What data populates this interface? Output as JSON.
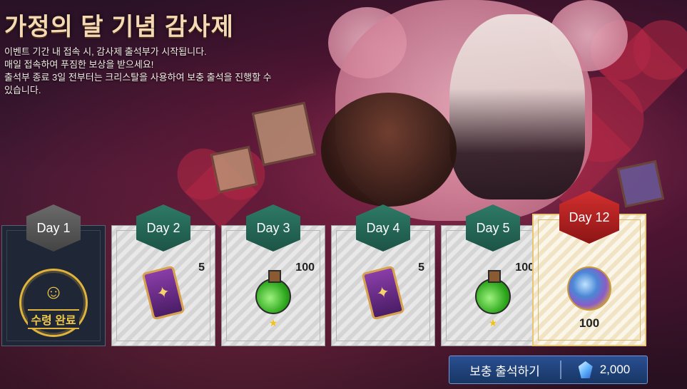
{
  "event": {
    "title": "가정의 달 기념 감사제",
    "description": [
      "이벤트 기간 내 접속 시, 감사제 출석부가 시작됩니다.",
      "매일 접속하여 푸짐한 보상을 받으세요!",
      "출석부 종료 3일 전부터는 크리스탈을 사용하여 보충 출석을 진행할 수",
      "있습니다."
    ]
  },
  "days": [
    {
      "label": "Day 1",
      "status": "received",
      "stamp_text": "수령 완료"
    },
    {
      "label": "Day 2",
      "quantity": "5",
      "item_icon": "card-item-icon"
    },
    {
      "label": "Day 3",
      "quantity": "100",
      "item_icon": "potion-icon",
      "star": "★"
    },
    {
      "label": "Day 4",
      "quantity": "5",
      "item_icon": "card-item-icon"
    },
    {
      "label": "Day 5",
      "quantity": "100",
      "item_icon": "potion-icon",
      "star": "★"
    },
    {
      "label": "Day 12",
      "quantity": "100",
      "item_icon": "gem-icon",
      "special": true
    }
  ],
  "makeup_button": {
    "label": "보충 출석하기",
    "cost": "2,000",
    "cost_icon": "crystal-icon"
  },
  "colors": {
    "title": "#f5d9b5",
    "day_badge_green": "#2e7a66",
    "day_badge_red": "#d2302f",
    "makeup_button": "#2a4f92",
    "stamp_gold": "#e0b43c"
  }
}
